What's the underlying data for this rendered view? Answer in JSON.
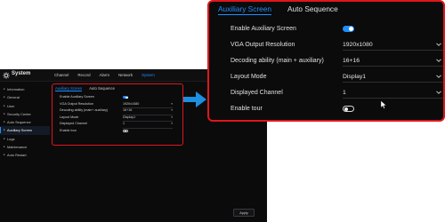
{
  "screenshot": {
    "app_title": "System",
    "top_menu": [
      "Channel",
      "Record",
      "Alarm",
      "Network",
      "System"
    ],
    "top_menu_active_index": 4,
    "sidebar": [
      "Information",
      "General",
      "User",
      "Security Center",
      "Auto Sequence",
      "Auxiliary Screen",
      "Logs",
      "Maintenance",
      "Auto Restart"
    ],
    "sidebar_active_index": 5,
    "tabs": [
      "Auxiliary Screen",
      "Auto Sequence"
    ],
    "rows": [
      {
        "label": "Enable Auxiliary Screen",
        "value": ""
      },
      {
        "label": "VGA Output Resolution",
        "value": "1920x1080"
      },
      {
        "label": "Decoding ability (main+ auxiliary)",
        "value": "16+16"
      },
      {
        "label": "Layout Mode",
        "value": "Display1"
      },
      {
        "label": "Displayed Channel",
        "value": "1"
      },
      {
        "label": "Enable tour",
        "value": ""
      }
    ],
    "apply_label": "Apply"
  },
  "zoom": {
    "tabs": [
      "Auxiliary Screen",
      "Auto Sequence"
    ],
    "active_tab_index": 0,
    "enable_auxiliary": {
      "label": "Enable Auxiliary Screen",
      "enabled": true
    },
    "vga_output": {
      "label": "VGA Output Resolution",
      "value": "1920x1080"
    },
    "decoding": {
      "label": "Decoding ability (main + auxiliary)",
      "value": "16+16"
    },
    "layout_mode": {
      "label": "Layout Mode",
      "value": "Display1"
    },
    "displayed_channel": {
      "label": "Displayed Channel",
      "value": "1"
    },
    "enable_tour": {
      "label": "Enable tour",
      "enabled": false
    }
  },
  "colors": {
    "accent": "#1f8fff",
    "highlight_border": "#e0161b",
    "background": "#0b0b0c",
    "arrow": "#1d8fe1"
  },
  "icons": {
    "logo": "gear-icon",
    "caret": "chevron-down-icon",
    "sidebar_chevron": "chevron-right-icon",
    "pointer": "mouse-cursor-icon",
    "callout": "arrow-right-icon"
  }
}
